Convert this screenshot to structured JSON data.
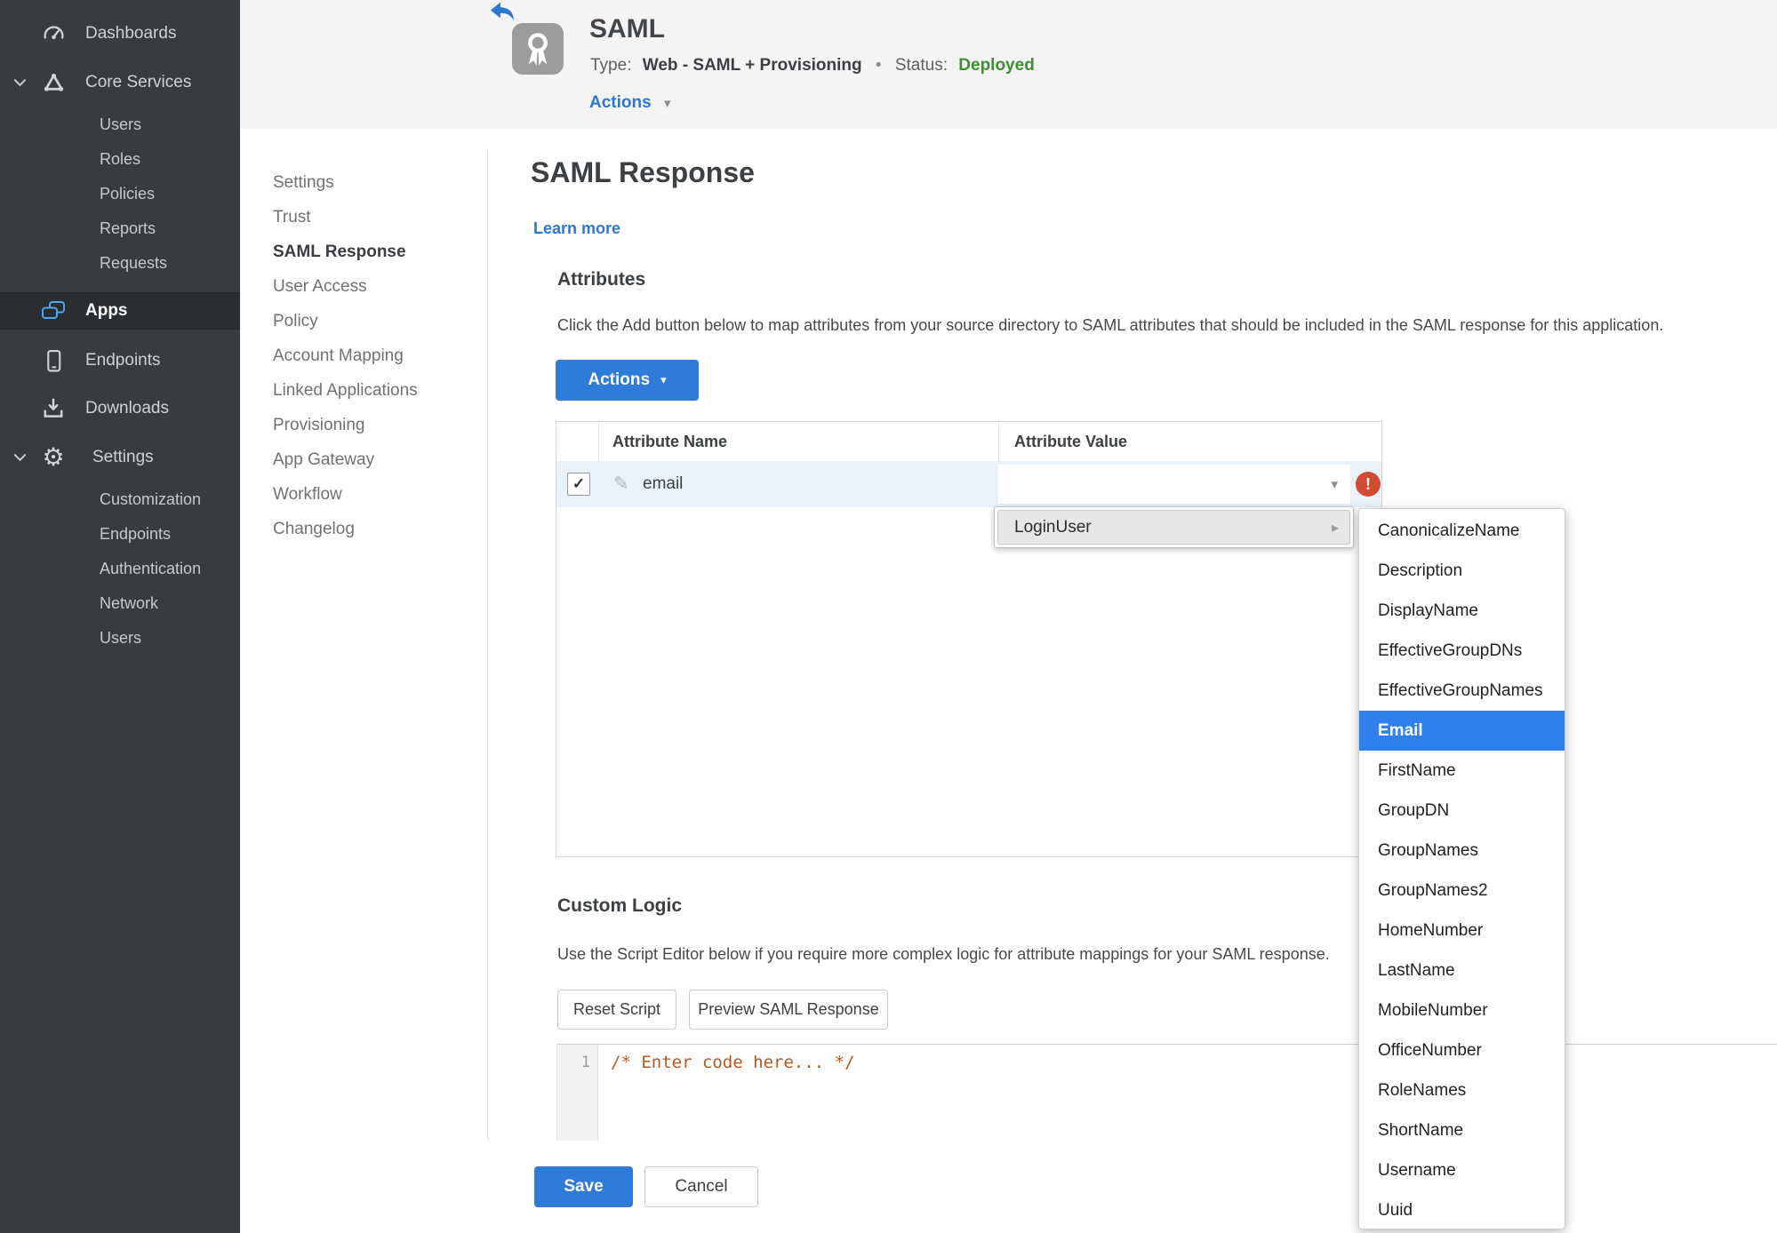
{
  "sidebar": {
    "active_item": "Apps",
    "items": [
      {
        "label": "Dashboards"
      },
      {
        "label": "Core Services"
      },
      {
        "label": "Users"
      },
      {
        "label": "Roles"
      },
      {
        "label": "Policies"
      },
      {
        "label": "Reports"
      },
      {
        "label": "Requests"
      },
      {
        "label": "Apps"
      },
      {
        "label": "Endpoints"
      },
      {
        "label": "Downloads"
      },
      {
        "label": "Settings"
      },
      {
        "label": "Customization"
      },
      {
        "label": "Endpoints"
      },
      {
        "label": "Authentication"
      },
      {
        "label": "Network"
      },
      {
        "label": "Users"
      }
    ]
  },
  "header": {
    "app_title": "SAML",
    "type_label": "Type:",
    "type_value": "Web - SAML + Provisioning",
    "separator": "•",
    "status_label": "Status:",
    "status_value": "Deployed",
    "actions_label": "Actions"
  },
  "subnav": {
    "active": "SAML Response",
    "items": [
      "Settings",
      "Trust",
      "SAML Response",
      "User Access",
      "Policy",
      "Account Mapping",
      "Linked Applications",
      "Provisioning",
      "App Gateway",
      "Workflow",
      "Changelog"
    ]
  },
  "main": {
    "title": "SAML Response",
    "learn_more": "Learn more",
    "attributes": {
      "heading": "Attributes",
      "description": "Click the Add button below to map attributes from your source directory to SAML attributes that should be included in the SAML response for this application.",
      "actions_button": "Actions",
      "table": {
        "columns": [
          "Attribute Name",
          "Attribute Value"
        ],
        "rows": [
          {
            "checked": true,
            "name": "email",
            "value": ""
          }
        ]
      }
    },
    "value_menu": {
      "root_item": "LoginUser",
      "selected": "Email",
      "options": [
        "CanonicalizeName",
        "Description",
        "DisplayName",
        "EffectiveGroupDNs",
        "EffectiveGroupNames",
        "Email",
        "FirstName",
        "GroupDN",
        "GroupNames",
        "GroupNames2",
        "HomeNumber",
        "LastName",
        "MobileNumber",
        "OfficeNumber",
        "RoleNames",
        "ShortName",
        "Username",
        "Uuid"
      ]
    },
    "custom_logic": {
      "heading": "Custom Logic",
      "description": "Use the Script Editor below if you require more complex logic for attribute mappings for your SAML response.",
      "reset_button": "Reset Script",
      "preview_button": "Preview SAML Response",
      "editor": {
        "line_number": "1",
        "code": "/* Enter code here... */"
      }
    },
    "save_button": "Save",
    "cancel_button": "Cancel"
  },
  "icons": {
    "check": "✓",
    "caret_down": "▾",
    "caret_right": "▸",
    "pencil": "✎",
    "error_mark": "!",
    "separator_dot": "•"
  },
  "colors": {
    "accent_blue": "#2e77d0",
    "button_blue": "#2f7bd9",
    "menu_highlight_blue": "#2f80ed",
    "status_green": "#3e8f33",
    "error_red": "#d14b32",
    "sidebar_bg": "#383c3f",
    "row_highlight_blue": "#e9f2fb",
    "code_orange": "#b35a22"
  }
}
